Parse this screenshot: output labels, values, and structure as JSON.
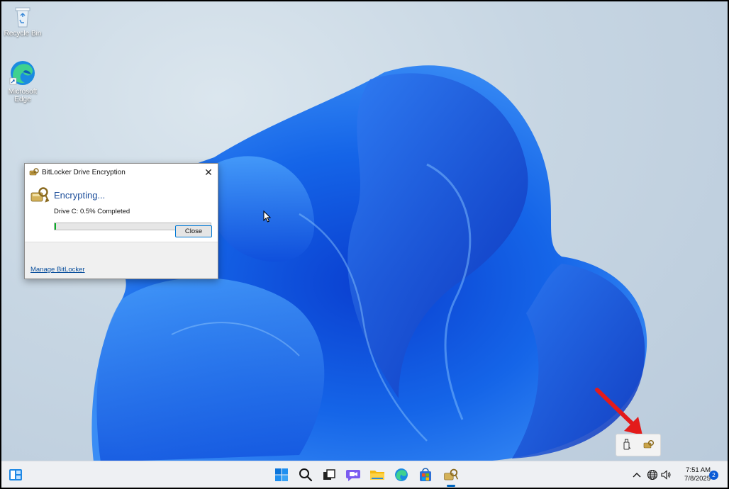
{
  "desktop": {
    "icons": [
      {
        "label": "Recycle Bin"
      },
      {
        "label": "Microsoft Edge"
      }
    ]
  },
  "bitlocker_window": {
    "title": "BitLocker Drive Encryption",
    "heading": "Encrypting...",
    "status": "Drive C: 0.5% Completed",
    "progress_percent": 0.5,
    "close_button": "Close",
    "manage_link": "Manage BitLocker"
  },
  "taskbar": {
    "apps": [
      "start-icon",
      "search-icon",
      "task-view-icon",
      "chat-icon",
      "file-explorer-icon",
      "edge-icon",
      "store-icon",
      "bitlocker-icon"
    ],
    "clock": {
      "time": "7:51 AM",
      "date": "7/8/2025"
    },
    "notification_count": "2"
  },
  "colors": {
    "accent": "#0067c0",
    "progress": "#06b025",
    "link": "#0a4f9c",
    "annotation_arrow": "#e31b1b"
  }
}
